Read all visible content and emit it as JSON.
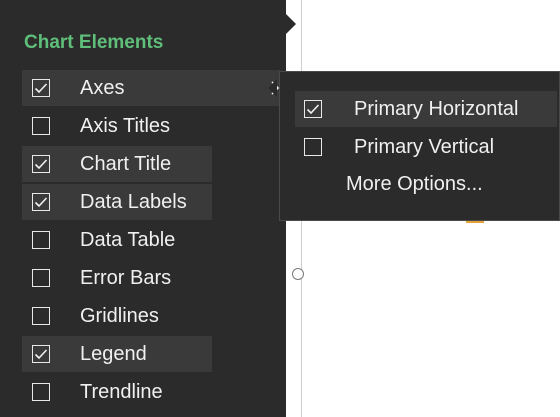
{
  "chart_elements": {
    "title": "Chart Elements",
    "items": [
      {
        "label": "Axes",
        "checked": true
      },
      {
        "label": "Axis Titles",
        "checked": false
      },
      {
        "label": "Chart Title",
        "checked": true
      },
      {
        "label": "Data Labels",
        "checked": true
      },
      {
        "label": "Data Table",
        "checked": false
      },
      {
        "label": "Error Bars",
        "checked": false
      },
      {
        "label": "Gridlines",
        "checked": false
      },
      {
        "label": "Legend",
        "checked": true
      },
      {
        "label": "Trendline",
        "checked": false
      }
    ]
  },
  "axes_submenu": {
    "items": [
      {
        "label": "Primary Horizontal",
        "checked": true
      },
      {
        "label": "Primary Vertical",
        "checked": false
      }
    ],
    "more_options": "More Options..."
  },
  "colors": {
    "panel_bg": "#2b2b2b",
    "title_green": "#5fbf7a",
    "highlight": "#3a3a3a",
    "text": "#f0f0f0"
  }
}
